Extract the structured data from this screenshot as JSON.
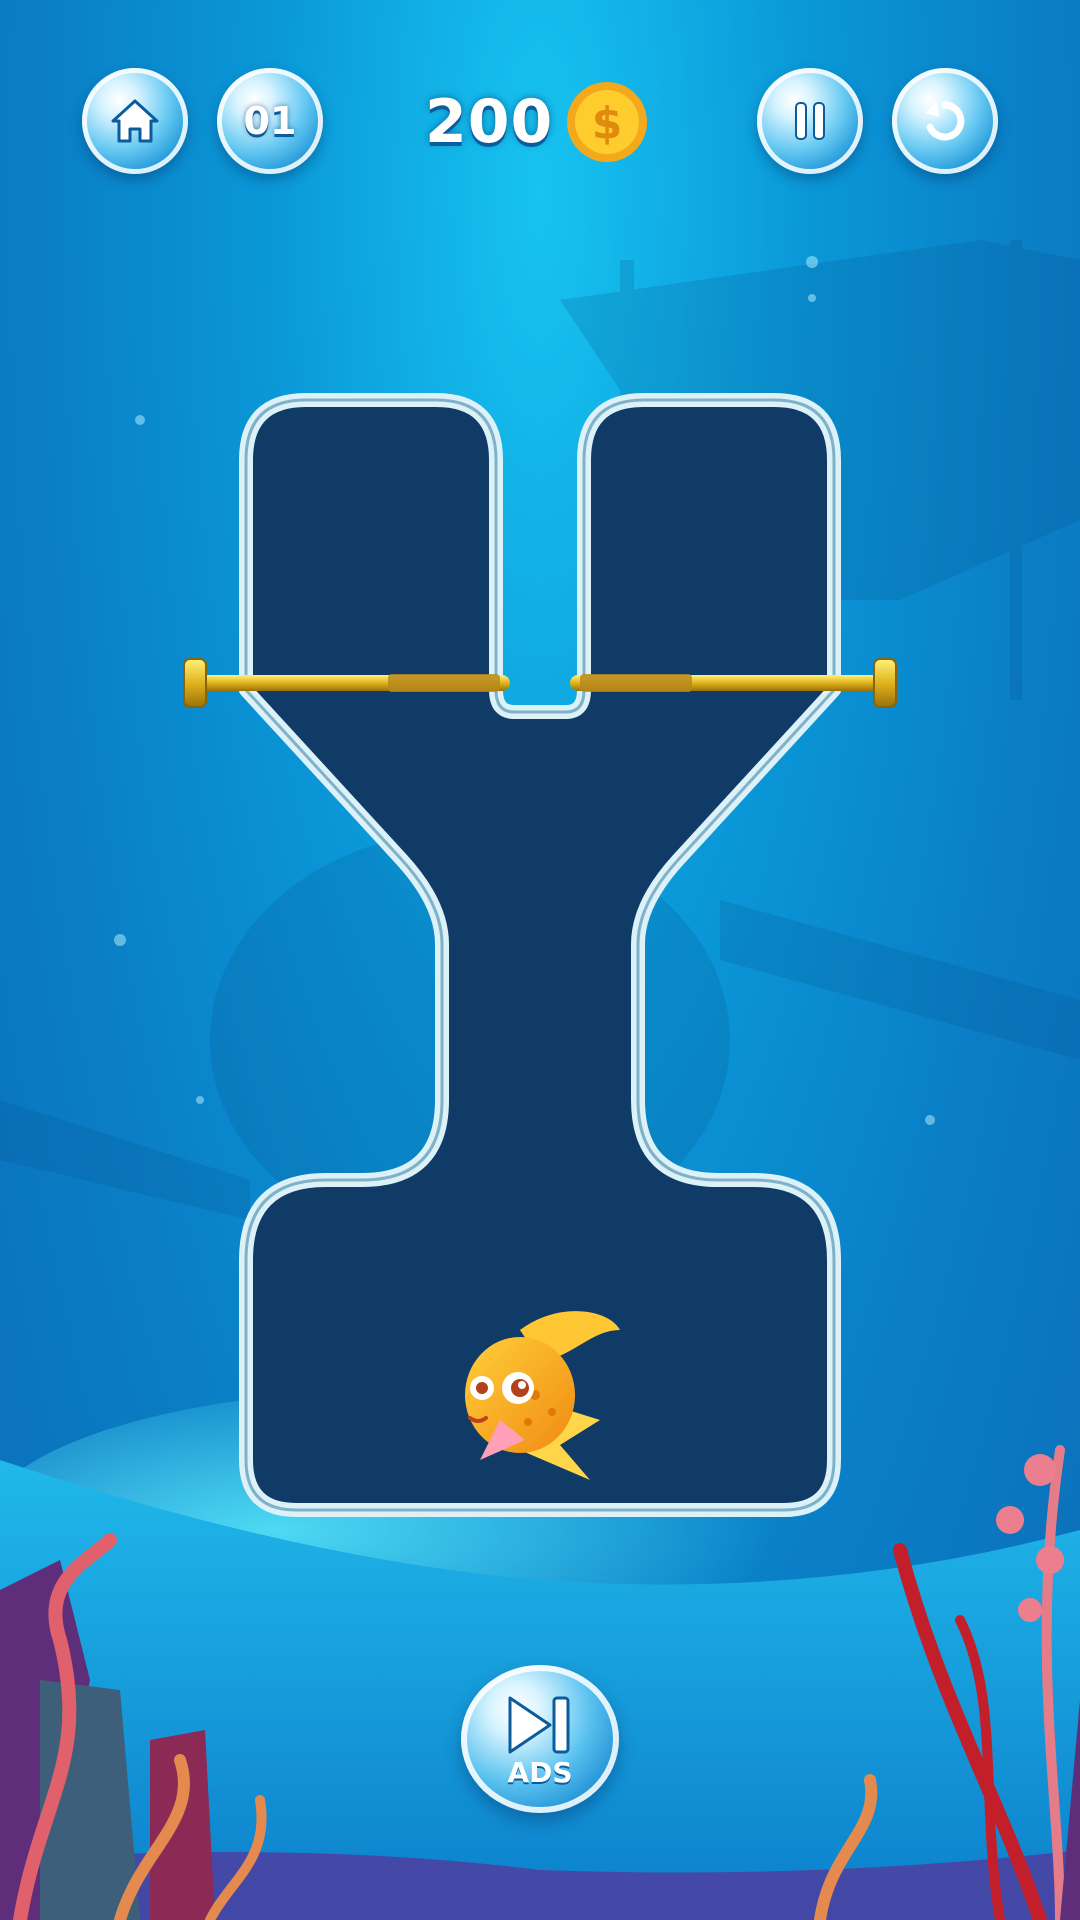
{
  "hud": {
    "level": "01",
    "coins": "200"
  },
  "ads_button": {
    "label": "ADS"
  },
  "icons": [
    "home-icon",
    "pause-icon",
    "restart-icon",
    "coin-icon",
    "skip-icon"
  ],
  "colors": {
    "water_top": "#17c3f0",
    "water_bottom": "#0b6db8",
    "vessel_fill": "#0f3b66",
    "pipe": "#d8eef6",
    "pin": "#e2b81c",
    "fish": "#f7a51c"
  }
}
